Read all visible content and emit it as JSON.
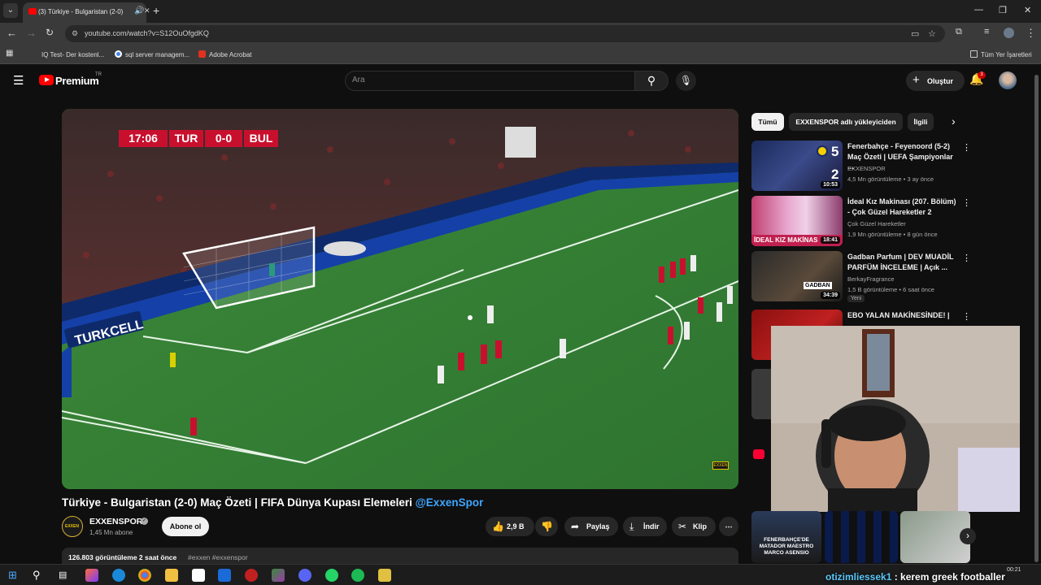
{
  "browser": {
    "tab_title": "(3) Türkiye - Bulgaristan (2-0)",
    "url": "youtube.com/watch?v=S12OuOfgdKQ",
    "bookmarks": [
      "IQ Test- Der kostenl...",
      "sql server managem...",
      "Adobe Acrobat"
    ],
    "all_bookmarks": "Tüm Yer İşaretleri"
  },
  "header": {
    "logo_text": "Premium",
    "region": "TR",
    "search_placeholder": "Ara",
    "create_label": "Oluştur",
    "notif_count": "3"
  },
  "player": {
    "clock": "17:06",
    "team1": "TUR",
    "score": "0-0",
    "team2": "BUL",
    "watermark": "EXXEN"
  },
  "video": {
    "title": "Türkiye - Bulgaristan (2-0) Maç Özeti | FIFA Dünya Kupası Elemeleri ",
    "title_tag": "@ExxenSpor",
    "channel": "EXXENSPOR",
    "subs": "1,45 Mn abone",
    "subscribe": "Abone ol",
    "likes": "2,9 B",
    "share": "Paylaş",
    "download": "İndir",
    "clip": "Klip",
    "stats": "126.803 görüntüleme  2 saat önce",
    "hashtags": "#exxen #exxenspor"
  },
  "sidebar": {
    "chips": [
      "Tümü",
      "EXXENSPOR adlı yükleyiciden",
      "İlgili"
    ],
    "recs": [
      {
        "title": "Fenerbahçe - Feyenoord (5-2) Maç Özeti | UEFA Şampiyonlar ...",
        "channel": "EXXENSPOR",
        "meta": "4,5 Mn görüntüleme • 3 ay önce",
        "duration": "10:53",
        "score_a": "5",
        "score_b": "2"
      },
      {
        "title": "İdeal Kız Makinası (207. Bölüm) - Çok Güzel Hareketler 2",
        "channel": "Çok Güzel Hareketler",
        "meta": "1,9 Mn görüntüleme • 8 gün önce",
        "duration": "18:41",
        "banner": "İDEAL KIZ MAKİNAS"
      },
      {
        "title": "Gadban Parfum | DEV MUADİL PARFÜM İNCELEME | Açık ...",
        "channel": "BerkayFragrance",
        "meta": "1,5 B görüntüleme • 6 saat önce",
        "duration": "34:39",
        "badge": "Yeni",
        "thumb_text": "GADBAN"
      },
      {
        "title": "EBO YALAN MAKİNESİNDE! |",
        "channel": "",
        "meta": "",
        "duration": ""
      }
    ],
    "short1_text": "FENERBAHÇE'DE MATADOR MAESTRO MARCO ASENSIO"
  },
  "taskbar": {
    "clock_time": "00:21",
    "overlay_user": "otizimliessek1",
    "overlay_msg": " : kerem greek footballer"
  }
}
